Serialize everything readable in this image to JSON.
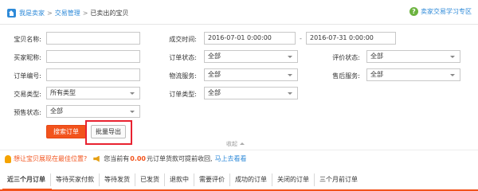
{
  "breadcrumb": {
    "items": [
      "我是卖家",
      "交易管理",
      "已卖出的宝贝"
    ],
    "separator": ">"
  },
  "help": {
    "label": "卖家交易学习专区"
  },
  "filters": {
    "item_name": {
      "label": "宝贝名称:",
      "value": ""
    },
    "deal_time": {
      "label": "成交时间:",
      "from": "2016-07-01 0:00:00",
      "to": "2016-07-31 0:00:00",
      "separator": "-"
    },
    "buyer_nick": {
      "label": "买家昵称:",
      "value": ""
    },
    "order_status": {
      "label": "订单状态:",
      "value": "全部"
    },
    "rating_status": {
      "label": "评价状态:",
      "value": "全部"
    },
    "order_no": {
      "label": "订单编号:",
      "value": ""
    },
    "logistics": {
      "label": "物流服务:",
      "value": "全部"
    },
    "after_sales": {
      "label": "售后服务:",
      "value": "全部"
    },
    "trade_type": {
      "label": "交易类型:",
      "value": "所有类型"
    },
    "order_type": {
      "label": "订单类型:",
      "value": "全部"
    },
    "presale_status": {
      "label": "预售状态:",
      "value": "全部"
    }
  },
  "actions": {
    "search": "搜索订单",
    "export": "批量导出",
    "collapse": "收起"
  },
  "notice": {
    "link_a": "想让宝贝展现在最佳位置?",
    "text_prefix": "您当前有",
    "amount": "0.00",
    "text_suffix": "元订单货款可提前收回,",
    "link_b": "马上去看看"
  },
  "tabs": [
    "近三个月订单",
    "等待买家付款",
    "等待发货",
    "已发货",
    "退款中",
    "需要评价",
    "成功的订单",
    "关闭的订单",
    "三个月前订单"
  ],
  "colors": {
    "accent": "#f2531c",
    "link": "#2e8ad8",
    "highlight_box": "#e82230"
  }
}
